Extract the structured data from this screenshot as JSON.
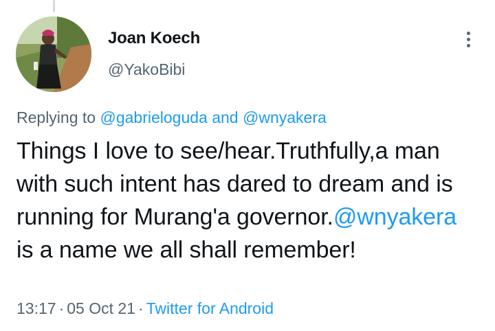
{
  "tweet": {
    "author_name": "Joan Koech",
    "author_handle": "@YakoBibi",
    "avatar_icon": "profile-photo",
    "more_icon": "more-options-icon",
    "replying_prefix": "Replying to",
    "replying_to_1": "@gabrieloguda",
    "replying_and": "and",
    "replying_to_2": "@wnyakera",
    "text_part1": "Things I love to see/hear.Truthfully,a man with such intent has dared to dream and is running for Murang'a governor.",
    "text_mention": "@wnyakera",
    "text_part2": " is a name we all shall remember!",
    "time": "13:17",
    "date": "05 Oct 21",
    "separator": "·",
    "source": "Twitter for Android"
  },
  "colors": {
    "text": "#0f1419",
    "secondary": "#536471",
    "link": "#1d9bf0"
  }
}
